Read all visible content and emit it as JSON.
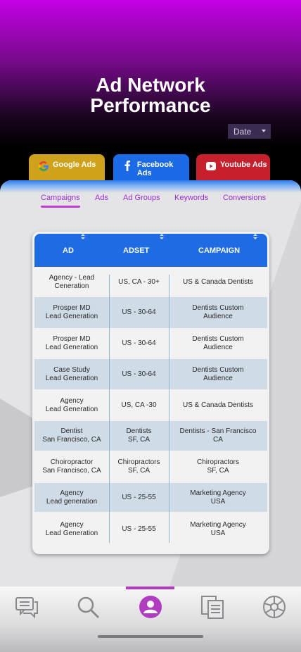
{
  "header": {
    "title_line1": "Ad Network",
    "title_line2": "Performance",
    "date_select": "Date"
  },
  "networks": [
    {
      "label": "Google Ads",
      "icon": "google-icon",
      "color": "#d0a11a"
    },
    {
      "label": "Facebook Ads",
      "icon": "facebook-icon",
      "color": "#1c6be6"
    },
    {
      "label": "Youtube Ads",
      "icon": "youtube-icon",
      "color": "#c6202c"
    }
  ],
  "subtabs": [
    "Campaigns",
    "Ads",
    "Ad Groups",
    "Keywords",
    "Conversions"
  ],
  "active_subtab": "Campaigns",
  "table": {
    "columns": [
      "AD",
      "ADSET",
      "CAMPAIGN"
    ],
    "rows": [
      [
        "Agency - Lead\nCeneration",
        "US, CA - 30+",
        "US & Canada Dentists"
      ],
      [
        "Prosper MD\nLead Generation",
        "US - 30-64",
        "Dentists Custom\nAudience"
      ],
      [
        "Prosper MD\nLead Generation",
        "US - 30-64",
        "Dentists Custom\nAudience"
      ],
      [
        "Case Study\nLead Generation",
        "US - 30-64",
        "Dentists Custom\nAudience"
      ],
      [
        "Agency\nLead Generation",
        "US, CA -30",
        "US & Canada Dentists"
      ],
      [
        "Dentist\nSan Francisco, CA",
        "Dentists\nSF,  CA",
        "Dentists - San Francisco\nCA"
      ],
      [
        "Choiropractor\nSan Francisco, CA",
        "Chiropractors\nSF, CA",
        "Chiropractors\nSF, CA"
      ],
      [
        "Agency\nLead generation",
        "US - 25-55",
        "Marketing Agency\nUSA"
      ],
      [
        "Agency\nLead Generation",
        "US - 25-55",
        "Marketing Agency\nUSA"
      ]
    ]
  },
  "bottom_nav": [
    {
      "icon": "chat-icon"
    },
    {
      "icon": "search-icon"
    },
    {
      "icon": "profile-icon",
      "active": true
    },
    {
      "icon": "documents-icon"
    },
    {
      "icon": "globe-icon"
    }
  ],
  "colors": {
    "accent": "#b03dc0",
    "table_header": "#1e6be4",
    "row_alt": "#cfdbe7"
  }
}
